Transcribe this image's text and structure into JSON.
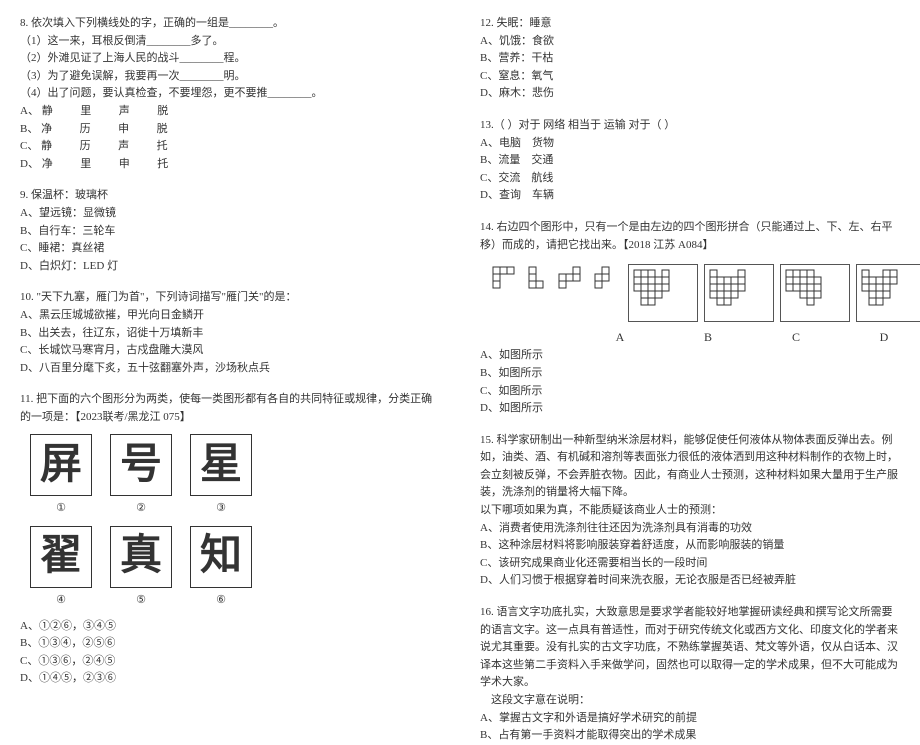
{
  "left": {
    "q8": {
      "stem": "8. 依次填入下列横线处的字，正确的一组是________。",
      "l1": "（1）这一来，耳根反倒清________多了。",
      "l2": "（2）外滩见证了上海人民的战斗________程。",
      "l3": "（3）为了避免误解，我要再一次________明。",
      "l4": "（4）出了问题，要认真检查，不要埋怨，更不要推________。",
      "optA": "A、 静          里          声          脱",
      "optB": "B、 净          历          申          脱",
      "optC": "C、 静          历          声          托",
      "optD": "D、 净          里          申          托"
    },
    "q9": {
      "stem": "9. 保温杯：玻璃杯",
      "optA": "A、望远镜：显微镜",
      "optB": "B、自行车：三轮车",
      "optC": "C、睡裙：真丝裙",
      "optD": "D、白炽灯：LED 灯"
    },
    "q10": {
      "stem": "10. \"天下九塞，雁门为首\"，下列诗词描写\"雁门关\"的是：",
      "optA": "A、黑云压城城欲摧，甲光向日金鳞开",
      "optB": "B、出关去，往辽东，诏徙十万填新丰",
      "optC": "C、长城饮马寒宵月，古戍盘雕大漠风",
      "optD": "D、八百里分麾下炙，五十弦翻塞外声，沙场秋点兵"
    },
    "q11": {
      "stem": "11. 把下面的六个图形分为两类，使每一类图形都有各自的共同特征或规律，分类正确的一项是：【2023联考/黑龙江 075】",
      "chars": [
        "屏",
        "号",
        "星",
        "翟",
        "真",
        "知"
      ],
      "labels": [
        "①",
        "②",
        "③",
        "④",
        "⑤",
        "⑥"
      ],
      "optA": "A、①②⑥，③④⑤",
      "optB": "B、①③④，②⑤⑥",
      "optC": "C、①③⑥，②④⑤",
      "optD": "D、①④⑤，②③⑥"
    }
  },
  "right": {
    "q12": {
      "stem": "12. 失眠：睡意",
      "optA": "A、饥饿：食欲",
      "optB": "B、营养：干枯",
      "optC": "C、窒息：氧气",
      "optD": "D、麻木：悲伤"
    },
    "q13": {
      "stem": "13.（    ）对于    网络    相当于    运输    对于（    ）",
      "optA": "A、电脑    货物",
      "optB": "B、流量    交通",
      "optC": "C、交流    航线",
      "optD": "D、查询    车辆"
    },
    "q14": {
      "stem": "14. 右边四个图形中，只有一个是由左边的四个图形拼合（只能通过上、下、左、右平移）而成的，请把它找出来。【2018 江苏 A084】",
      "labels": [
        "A",
        "B",
        "C",
        "D"
      ],
      "optA": "A、如图所示",
      "optB": "B、如图所示",
      "optC": "C、如图所示",
      "optD": "D、如图所示"
    },
    "q15": {
      "stem": "15. 科学家研制出一种新型纳米涂层材料，能够促使任何液体从物体表面反弹出去。例如，油类、酒、有机碱和溶剂等表面张力很低的液体洒到用这种材料制作的衣物上时，会立刻被反弹，不会弄脏衣物。因此，有商业人士预测，这种材料如果大量用于生产服装，洗涤剂的销量将大幅下降。",
      "sub": "以下哪项如果为真，不能质疑该商业人士的预测：",
      "optA": "A、消费者使用洗涤剂往往还因为洗涤剂具有消毒的功效",
      "optB": "B、这种涂层材料将影响服装穿着舒适度，从而影响服装的销量",
      "optC": "C、该研究成果商业化还需要相当长的一段时间",
      "optD": "D、人们习惯于根据穿着时间来洗衣服，无论衣服是否已经被弄脏"
    },
    "q16": {
      "stem": "16. 语言文字功底扎实，大致意思是要求学者能较好地掌握研读经典和撰写论文所需要的语言文字。这一点具有普适性，而对于研究传统文化或西方文化、印度文化的学者来说尤其重要。没有扎实的古文字功底，不熟练掌握英语、梵文等外语，仅从白话本、汉译本这些第二手资料入手来做学问，固然也可以取得一定的学术成果，但不大可能成为学术大家。",
      "sub": "    这段文字意在说明：",
      "optA": "A、掌握古文字和外语是搞好学术研究的前提",
      "optB": "B、占有第一手资料才能取得突出的学术成果"
    }
  }
}
